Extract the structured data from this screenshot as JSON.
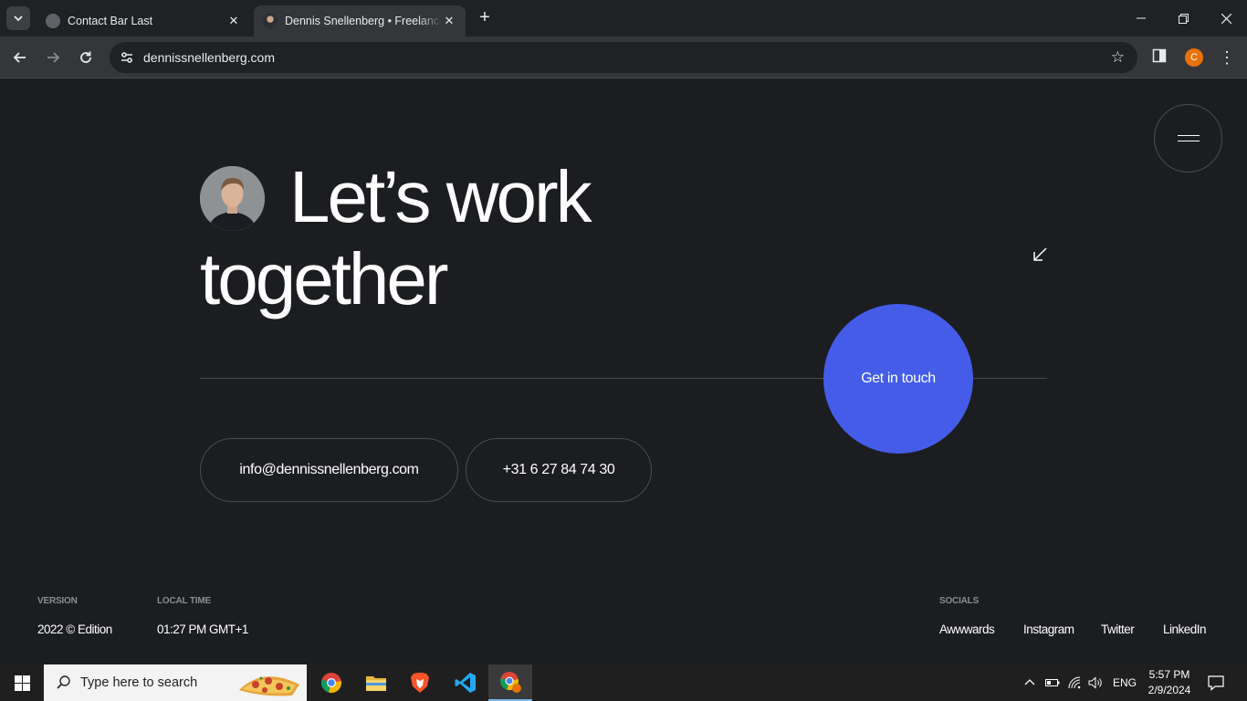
{
  "browser": {
    "tabs": [
      {
        "title": "Contact Bar Last",
        "active": false
      },
      {
        "title": "Dennis Snellenberg • Freelance Designer & Developer",
        "active": true
      }
    ],
    "new_tab_label": "+",
    "url": "dennissnellenberg.com",
    "profile_initial": "C"
  },
  "page": {
    "headline_line1": "Let’s work",
    "headline_line2": "together",
    "cta_label": "Get in touch",
    "email": "info@dennissnellenberg.com",
    "phone": "+31 6 27 84 74 30",
    "footer": {
      "version_label": "VERSION",
      "version_value": "2022 © Edition",
      "time_label": "LOCAL TIME",
      "time_value": "01:27 PM GMT+1",
      "socials_label": "SOCIALS",
      "socials": [
        "Awwwards",
        "Instagram",
        "Twitter",
        "LinkedIn"
      ]
    },
    "colors": {
      "background": "#1c1d20",
      "accent": "#455ce9"
    }
  },
  "taskbar": {
    "search_placeholder": "Type here to search",
    "language": "ENG",
    "time": "5:57 PM",
    "date": "2/9/2024"
  }
}
